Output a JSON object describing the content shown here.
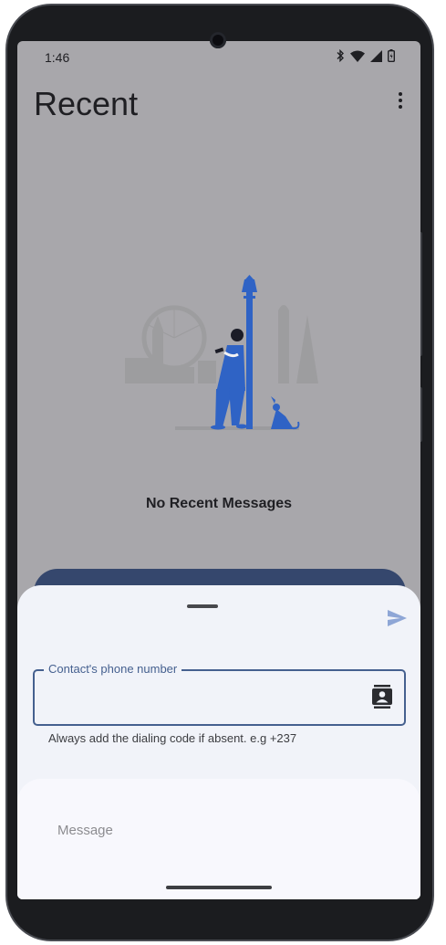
{
  "status_bar": {
    "time": "1:46",
    "icons": [
      "bluetooth-icon",
      "wifi-icon",
      "signal-icon",
      "battery-icon"
    ]
  },
  "app_bar": {
    "title": "Recent",
    "menu_icon": "more-vert-icon"
  },
  "empty_state": {
    "illustration": "person-with-phone-under-lamppost-illustration",
    "text": "No Recent Messages"
  },
  "compose_sheet": {
    "send_icon": "send-icon",
    "phone_field": {
      "label": "Contact's phone number",
      "value": "",
      "helper": "Always add the dialing code if absent. e.g +237",
      "trailing_icon": "contacts-icon"
    },
    "message_field": {
      "placeholder": "Message",
      "value": ""
    }
  },
  "colors": {
    "scrim": "#a8a7ab",
    "sheet": "#f1f3f9",
    "primary": "#45608f",
    "send": "#8ea6d6",
    "illustration_blue": "#2f63c5"
  }
}
